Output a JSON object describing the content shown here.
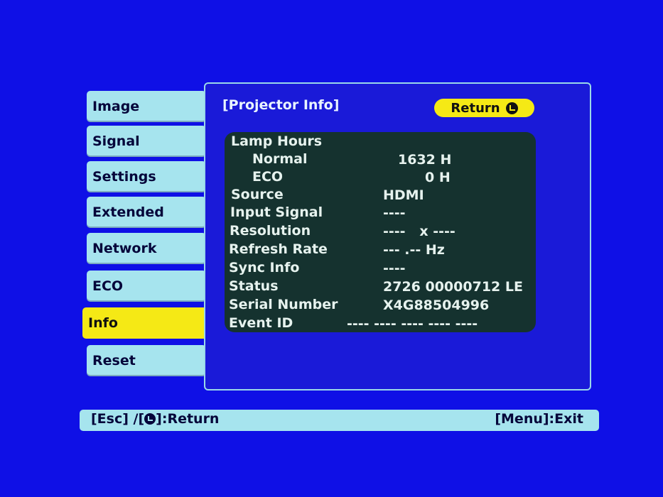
{
  "menu": {
    "items": [
      {
        "label": "Image"
      },
      {
        "label": "Signal"
      },
      {
        "label": "Settings"
      },
      {
        "label": "Extended"
      },
      {
        "label": "Network"
      },
      {
        "label": "ECO"
      },
      {
        "label": "Info"
      },
      {
        "label": "Reset"
      }
    ],
    "active": "Info"
  },
  "panel": {
    "title": "[Projector Info]",
    "return_label": "Return"
  },
  "info": {
    "lamp_hours_label": "Lamp Hours",
    "normal_label": "Normal",
    "normal_value": "1632 H",
    "eco_label": "ECO",
    "eco_value": "0 H",
    "source_label": "Source",
    "source_value": "HDMI",
    "input_signal_label": "Input Signal",
    "input_signal_value": "----",
    "resolution_label": "Resolution",
    "resolution_value": "----   x ----",
    "refresh_rate_label": "Refresh Rate",
    "refresh_rate_value": "--- .-- Hz",
    "sync_info_label": "Sync Info",
    "sync_info_value": "----",
    "status_label": "Status",
    "status_value": "2726 00000712 LE",
    "serial_label": "Serial Number",
    "serial_value": "X4G88504996",
    "event_id_label": "Event ID",
    "event_id_value": "---- ---- ---- ---- ----"
  },
  "footer": {
    "left_prefix": "[Esc] /[",
    "left_suffix": "]:Return",
    "right": "[Menu]:Exit"
  },
  "colors": {
    "background": "#0f10e6",
    "menu_item": "#a6e4ee",
    "active_item": "#f5e915",
    "info_box": "#15322f"
  }
}
